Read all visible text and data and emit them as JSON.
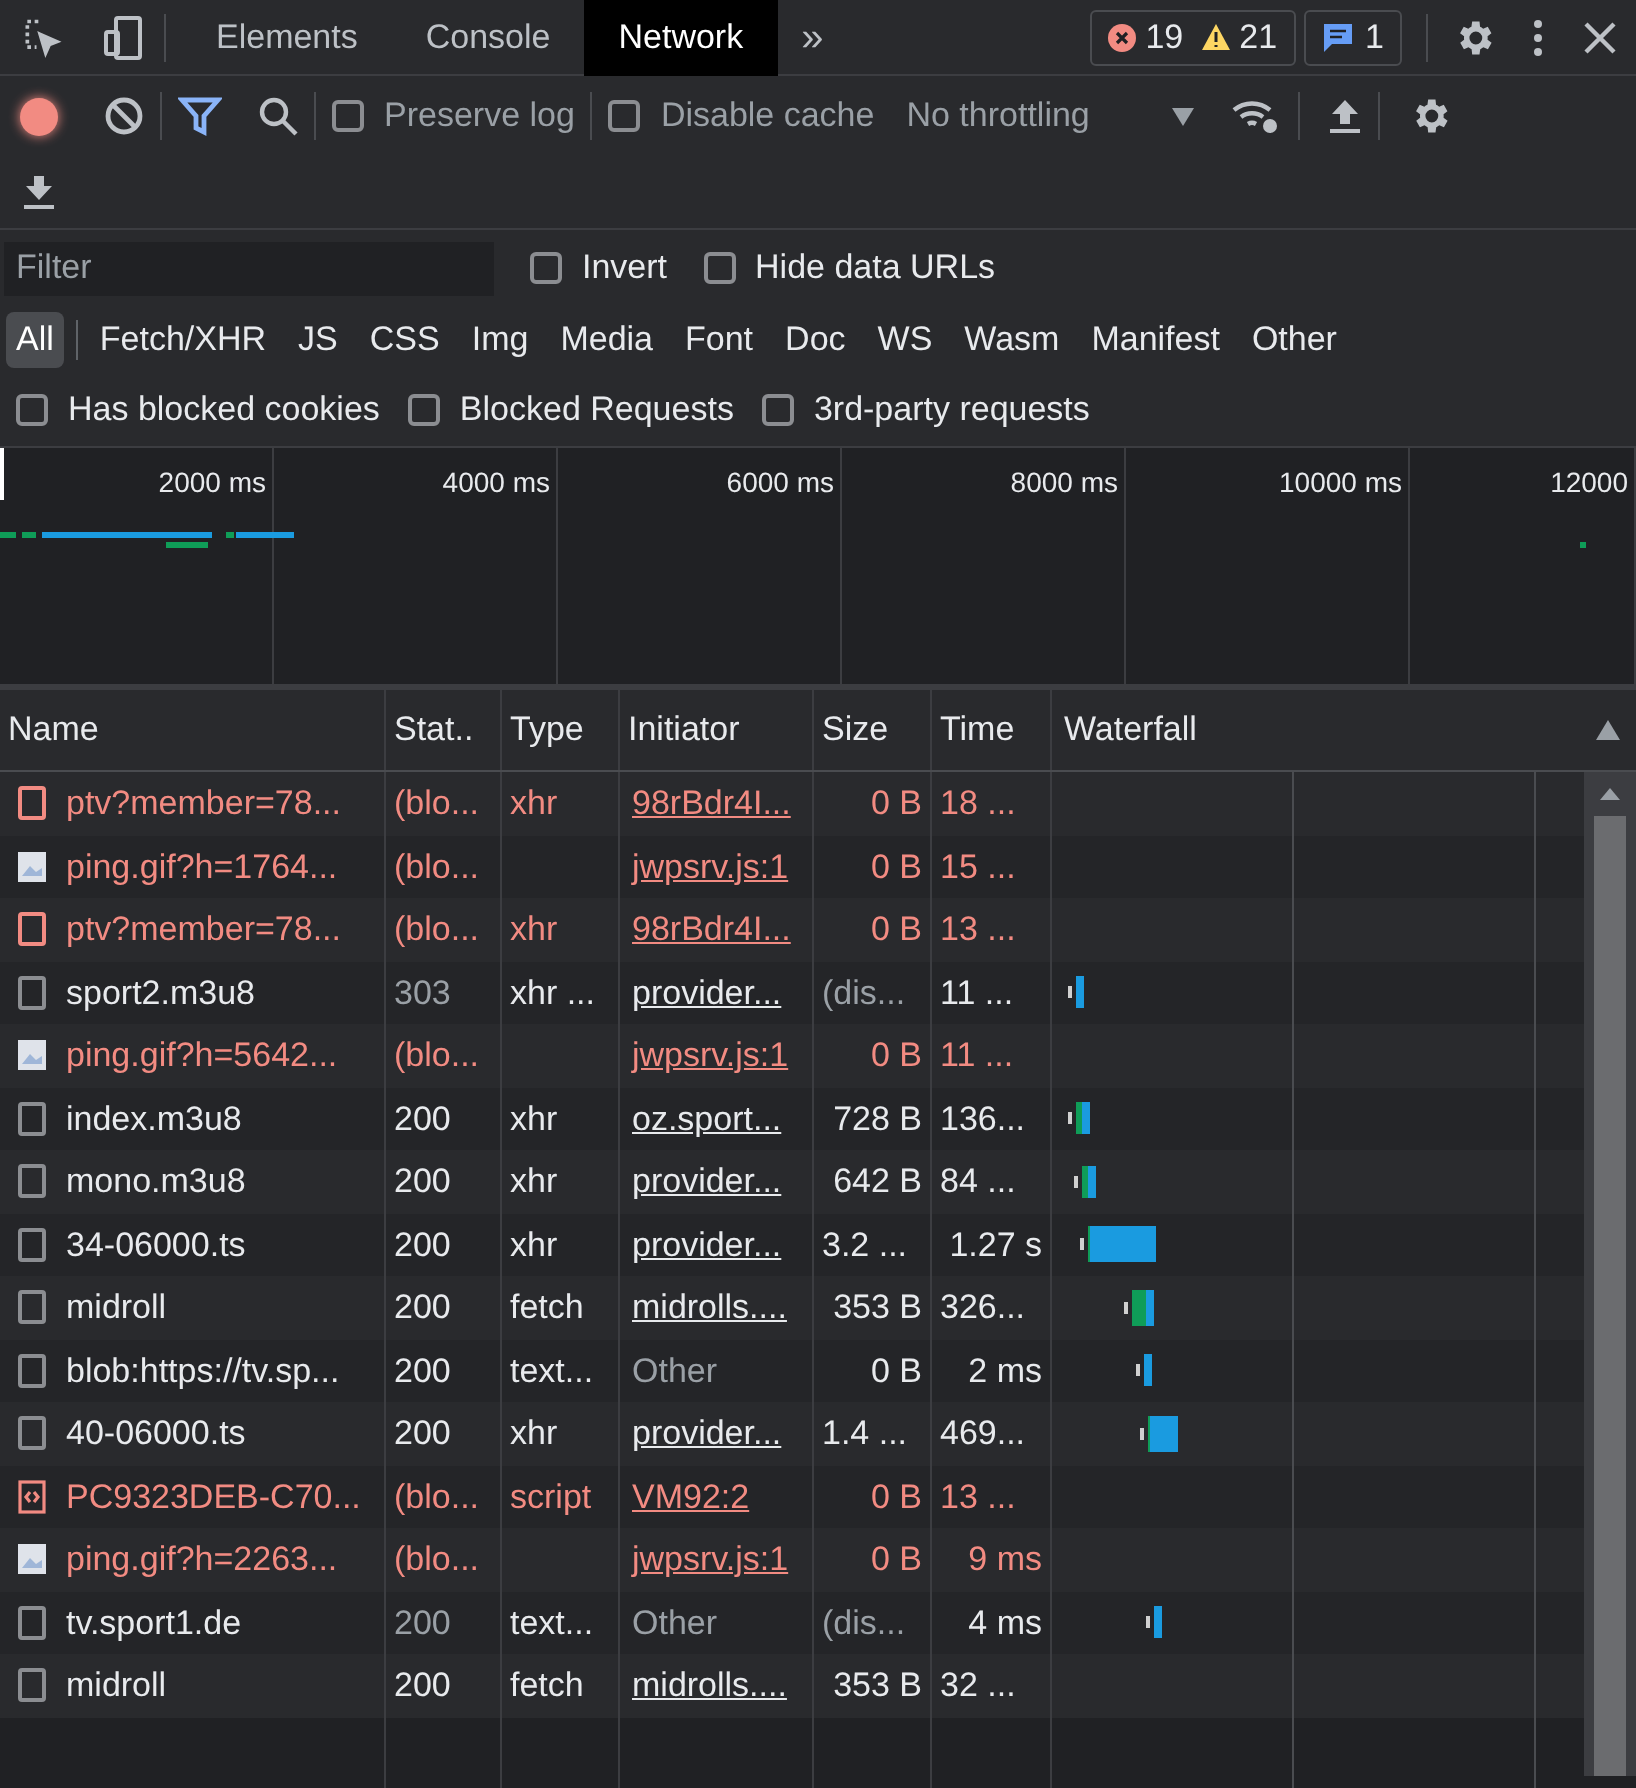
{
  "tabs": [
    {
      "label": "Elements",
      "selected": false
    },
    {
      "label": "Console",
      "selected": false
    },
    {
      "label": "Network",
      "selected": true
    }
  ],
  "more_tabs": "»",
  "counters": {
    "errors": "19",
    "warnings": "21",
    "messages": "1"
  },
  "toolbar": {
    "recording": true,
    "preserve_log": {
      "label": "Preserve log",
      "checked": false
    },
    "disable_cache": {
      "label": "Disable cache",
      "checked": false
    },
    "throttling": "No throttling"
  },
  "filter": {
    "placeholder": "Filter",
    "invert": {
      "label": "Invert",
      "checked": false
    },
    "hide_data_urls": {
      "label": "Hide data URLs",
      "checked": false
    }
  },
  "type_filters": [
    {
      "label": "All",
      "selected": true
    },
    {
      "label": "Fetch/XHR",
      "selected": false
    },
    {
      "label": "JS",
      "selected": false
    },
    {
      "label": "CSS",
      "selected": false
    },
    {
      "label": "Img",
      "selected": false
    },
    {
      "label": "Media",
      "selected": false
    },
    {
      "label": "Font",
      "selected": false
    },
    {
      "label": "Doc",
      "selected": false
    },
    {
      "label": "WS",
      "selected": false
    },
    {
      "label": "Wasm",
      "selected": false
    },
    {
      "label": "Manifest",
      "selected": false
    },
    {
      "label": "Other",
      "selected": false
    }
  ],
  "extra_filters": [
    {
      "label": "Has blocked cookies",
      "checked": false
    },
    {
      "label": "Blocked Requests",
      "checked": false
    },
    {
      "label": "3rd-party requests",
      "checked": false
    }
  ],
  "overview_ticks": [
    "2000 ms",
    "4000 ms",
    "6000 ms",
    "8000 ms",
    "10000 ms",
    "12000"
  ],
  "table": {
    "columns": [
      "Name",
      "Stat..",
      "Type",
      "Initiator",
      "Size",
      "Time",
      "Waterfall"
    ],
    "rows": [
      {
        "kind": "doc",
        "name": "ptv?member=78...",
        "blocked": true,
        "status": "(blo...",
        "status_muted": false,
        "type": "xhr",
        "initiator": "98rBdr4I...",
        "initiator_link": true,
        "size": "0 B",
        "size_muted": false,
        "time": "18 ..."
      },
      {
        "kind": "image",
        "name": "ping.gif?h=1764...",
        "blocked": true,
        "status": "(blo...",
        "status_muted": false,
        "type": "",
        "initiator": "jwpsrv.js:1",
        "initiator_link": true,
        "size": "0 B",
        "size_muted": false,
        "time": "15 ..."
      },
      {
        "kind": "doc",
        "name": "ptv?member=78...",
        "blocked": true,
        "status": "(blo...",
        "status_muted": false,
        "type": "xhr",
        "initiator": "98rBdr4I...",
        "initiator_link": true,
        "size": "0 B",
        "size_muted": false,
        "time": "13 ..."
      },
      {
        "kind": "doc",
        "name": "sport2.m3u8",
        "blocked": false,
        "status": "303",
        "status_muted": true,
        "type": "xhr ...",
        "initiator": "provider...",
        "initiator_link": true,
        "size": "(dis...",
        "size_muted": true,
        "time": "11 ..."
      },
      {
        "kind": "image",
        "name": "ping.gif?h=5642...",
        "blocked": true,
        "status": "(blo...",
        "status_muted": false,
        "type": "",
        "initiator": "jwpsrv.js:1",
        "initiator_link": true,
        "size": "0 B",
        "size_muted": false,
        "time": "11 ..."
      },
      {
        "kind": "doc",
        "name": "index.m3u8",
        "blocked": false,
        "status": "200",
        "status_muted": false,
        "type": "xhr",
        "initiator": "oz.sport...",
        "initiator_link": true,
        "size": "728 B",
        "size_muted": false,
        "time": "136..."
      },
      {
        "kind": "doc",
        "name": "mono.m3u8",
        "blocked": false,
        "status": "200",
        "status_muted": false,
        "type": "xhr",
        "initiator": "provider...",
        "initiator_link": true,
        "size": "642 B",
        "size_muted": false,
        "time": "84 ..."
      },
      {
        "kind": "doc",
        "name": "34-06000.ts",
        "blocked": false,
        "status": "200",
        "status_muted": false,
        "type": "xhr",
        "initiator": "provider...",
        "initiator_link": true,
        "size": "3.2 ...",
        "size_muted": false,
        "time": "1.27 s"
      },
      {
        "kind": "doc",
        "name": "midroll",
        "blocked": false,
        "status": "200",
        "status_muted": false,
        "type": "fetch",
        "initiator": "midrolls....",
        "initiator_link": true,
        "size": "353 B",
        "size_muted": false,
        "time": "326..."
      },
      {
        "kind": "doc",
        "name": "blob:https://tv.sp...",
        "blocked": false,
        "status": "200",
        "status_muted": false,
        "type": "text...",
        "initiator": "Other",
        "initiator_link": false,
        "size": "0 B",
        "size_muted": false,
        "time": "2 ms"
      },
      {
        "kind": "doc",
        "name": "40-06000.ts",
        "blocked": false,
        "status": "200",
        "status_muted": false,
        "type": "xhr",
        "initiator": "provider...",
        "initiator_link": true,
        "size": "1.4 ...",
        "size_muted": false,
        "time": "469..."
      },
      {
        "kind": "script",
        "name": "PC9323DEB-C70...",
        "blocked": true,
        "status": "(blo...",
        "status_muted": false,
        "type": "script",
        "initiator": "VM92:2",
        "initiator_link": true,
        "size": "0 B",
        "size_muted": false,
        "time": "13 ..."
      },
      {
        "kind": "image",
        "name": "ping.gif?h=2263...",
        "blocked": true,
        "status": "(blo...",
        "status_muted": false,
        "type": "",
        "initiator": "jwpsrv.js:1",
        "initiator_link": true,
        "size": "0 B",
        "size_muted": false,
        "time": "9 ms"
      },
      {
        "kind": "doc",
        "name": "tv.sport1.de",
        "blocked": false,
        "status": "200",
        "status_muted": true,
        "type": "text...",
        "initiator": "Other",
        "initiator_link": false,
        "size": "(dis...",
        "size_muted": true,
        "time": "4 ms"
      },
      {
        "kind": "doc",
        "name": "midroll",
        "blocked": false,
        "status": "200",
        "status_muted": false,
        "type": "fetch",
        "initiator": "midrolls....",
        "initiator_link": true,
        "size": "353 B",
        "size_muted": false,
        "time": "32 ..."
      }
    ]
  }
}
